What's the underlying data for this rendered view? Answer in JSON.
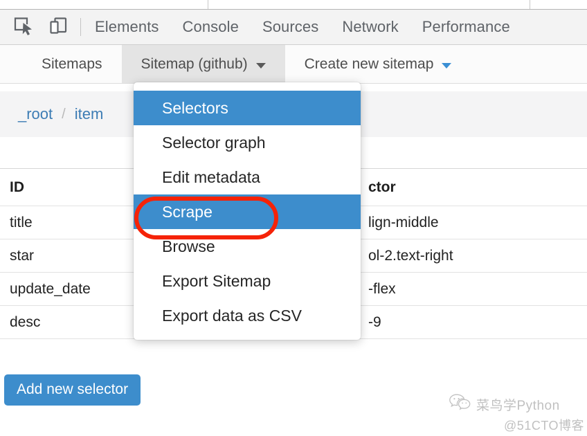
{
  "browser": {
    "tab_strip_visible": true
  },
  "devtools": {
    "icons": [
      {
        "name": "inspect-element-icon",
        "label": "Inspect element"
      },
      {
        "name": "device-toolbar-icon",
        "label": "Toggle device toolbar"
      }
    ],
    "panels": [
      {
        "label": "Elements",
        "active": false
      },
      {
        "label": "Console",
        "active": false
      },
      {
        "label": "Sources",
        "active": false
      },
      {
        "label": "Network",
        "active": false
      },
      {
        "label": "Performance",
        "active": false
      }
    ]
  },
  "sitemap_tabs": [
    {
      "label": "Sitemaps",
      "active": false,
      "caret": false
    },
    {
      "label": "Sitemap (github)",
      "active": true,
      "caret": true,
      "caret_color": "#5a5a5a"
    },
    {
      "label": "Create new sitemap",
      "active": false,
      "caret": true,
      "caret_color": "#3a8fd4"
    }
  ],
  "breadcrumb": {
    "items": [
      {
        "label": "_root"
      },
      {
        "label": "item"
      }
    ],
    "separator": "/"
  },
  "dropdown": {
    "items": [
      {
        "label": "Selectors",
        "selected": true
      },
      {
        "label": "Selector graph",
        "selected": false
      },
      {
        "label": "Edit metadata",
        "selected": false
      },
      {
        "label": "Scrape",
        "selected": true
      },
      {
        "label": "Browse",
        "selected": false
      },
      {
        "label": "Export Sitemap",
        "selected": false
      },
      {
        "label": "Export data as CSV",
        "selected": false
      }
    ]
  },
  "annotation": {
    "target_label": "Scrape",
    "color": "#f52308",
    "shape": "ellipse"
  },
  "table": {
    "headers": [
      "ID",
      "ctor"
    ],
    "rows": [
      {
        "id": "title",
        "selector": "lign-middle"
      },
      {
        "id": "star",
        "selector": "ol-2.text-right"
      },
      {
        "id": "update_date",
        "selector": "-flex"
      },
      {
        "id": "desc",
        "selector": "-9"
      }
    ]
  },
  "buttons": {
    "add_new_selector": "Add new selector"
  },
  "watermark": {
    "line1": "菜鸟学Python",
    "line2": "@51CTO博客",
    "icon": "wechat-icon"
  },
  "colors": {
    "accent_blue": "#3d8dcc",
    "link_blue": "#3c7cb4",
    "annotation_red": "#f52308",
    "toolbar_bg": "#f3f3f3",
    "tabbar_bg": "#fbfbfb",
    "active_tab_bg": "#e4e4e4",
    "breadcrumb_bg": "#f4f4f5"
  }
}
